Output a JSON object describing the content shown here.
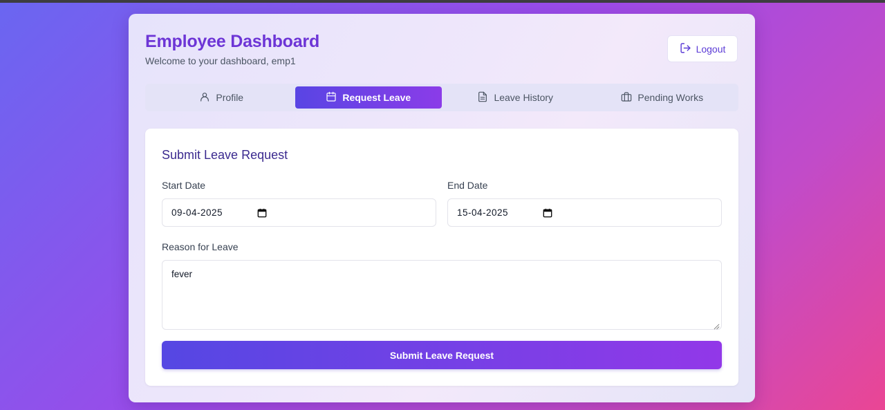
{
  "header": {
    "title": "Employee Dashboard",
    "subtitle": "Welcome to your dashboard, emp1",
    "logout_label": "Logout",
    "logout_icon": "logout-icon"
  },
  "tabs": [
    {
      "label": "Profile",
      "icon": "user-icon",
      "active": false
    },
    {
      "label": "Request Leave",
      "icon": "calendar-icon",
      "active": true
    },
    {
      "label": "Leave History",
      "icon": "document-icon",
      "active": false
    },
    {
      "label": "Pending Works",
      "icon": "briefcase-icon",
      "active": false
    }
  ],
  "form": {
    "title": "Submit Leave Request",
    "start_date": {
      "label": "Start Date",
      "value": "09-04-2025"
    },
    "end_date": {
      "label": "End Date",
      "value": "15-04-2025"
    },
    "reason": {
      "label": "Reason for Leave",
      "value": "fever"
    },
    "submit_label": "Submit Leave Request"
  },
  "colors": {
    "accent": "#6d35d6",
    "button_gradient_start": "#5547e3",
    "button_gradient_end": "#9238e8",
    "background_start": "#6a66f1",
    "background_end": "#ea4694"
  }
}
